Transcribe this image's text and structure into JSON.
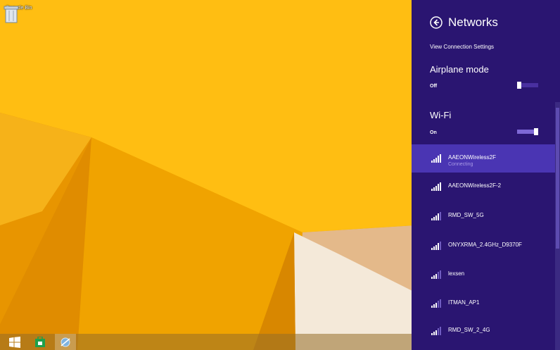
{
  "desktop": {
    "recycle_bin_label": "Recycle Bin",
    "colors": {
      "base": "#f2a800",
      "light": "#ffc21a",
      "dark": "#d98a00",
      "white_shape": "#f3e6d2"
    }
  },
  "taskbar": {
    "buttons": [
      {
        "icon": "windows-start-icon"
      },
      {
        "icon": "store-icon"
      },
      {
        "icon": "network-settings-icon"
      }
    ]
  },
  "networks_panel": {
    "title": "Networks",
    "view_connection_settings": "View Connection Settings",
    "airplane_mode": {
      "label": "Airplane mode",
      "state": "Off"
    },
    "wifi": {
      "label": "Wi-Fi",
      "state": "On"
    },
    "networks": [
      {
        "name": "AAEONWireless2F",
        "status": "Connecting"
      },
      {
        "name": "AAEONWireless2F-2",
        "status": ""
      },
      {
        "name": "RMD_SW_5G",
        "status": ""
      },
      {
        "name": "ONYXRMA_2.4GHz_D9370F",
        "status": ""
      },
      {
        "name": "lexsen",
        "status": ""
      },
      {
        "name": "ITMAN_AP1",
        "status": ""
      },
      {
        "name": "RMD_SW_2_4G",
        "status": ""
      }
    ],
    "colors": {
      "background": "#2a1571",
      "selected": "#4a35b3",
      "status_text": "#a99ae6"
    }
  }
}
